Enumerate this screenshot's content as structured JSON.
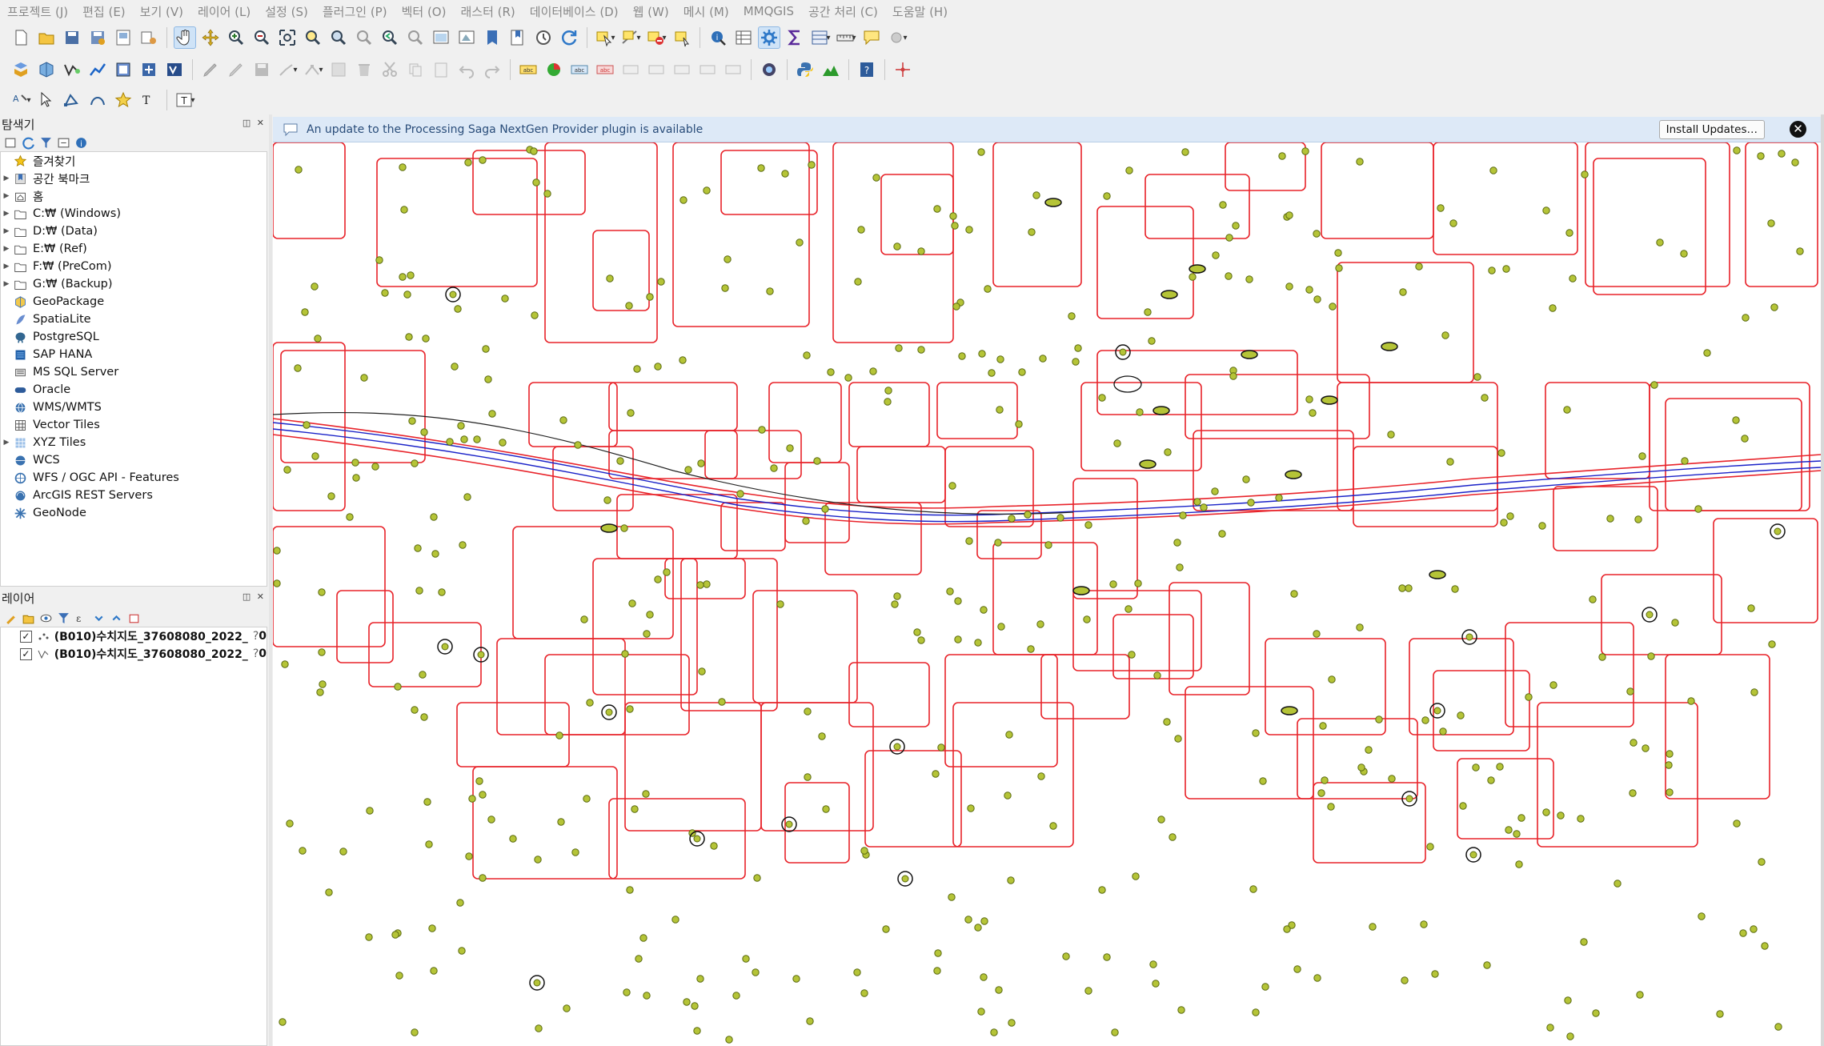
{
  "menu": [
    "프로젝트 (J)",
    "편집 (E)",
    "보기 (V)",
    "레이어 (L)",
    "설정 (S)",
    "플러그인 (P)",
    "벡터 (O)",
    "래스터 (R)",
    "데이터베이스 (D)",
    "웹 (W)",
    "메시 (M)",
    "MMQGIS",
    "공간 처리 (C)",
    "도움말 (H)"
  ],
  "browser": {
    "title": "탐색기",
    "items": [
      {
        "label": "즐겨찾기",
        "icon": "star-icon",
        "expandable": false
      },
      {
        "label": "공간 북마크",
        "icon": "bookmark-icon",
        "expandable": true
      },
      {
        "label": "홈",
        "icon": "home-folder-icon",
        "expandable": true
      },
      {
        "label": "C:₩ (Windows)",
        "icon": "folder-icon",
        "expandable": true
      },
      {
        "label": "D:₩ (Data)",
        "icon": "folder-icon",
        "expandable": true
      },
      {
        "label": "E:₩ (Ref)",
        "icon": "folder-icon",
        "expandable": true
      },
      {
        "label": "F:₩ (PreCom)",
        "icon": "folder-icon",
        "expandable": true
      },
      {
        "label": "G:₩ (Backup)",
        "icon": "folder-icon",
        "expandable": true
      },
      {
        "label": "GeoPackage",
        "icon": "geopackage-icon",
        "expandable": false
      },
      {
        "label": "SpatiaLite",
        "icon": "spatialite-icon",
        "expandable": false
      },
      {
        "label": "PostgreSQL",
        "icon": "postgresql-icon",
        "expandable": false
      },
      {
        "label": "SAP HANA",
        "icon": "sap-hana-icon",
        "expandable": false
      },
      {
        "label": "MS SQL Server",
        "icon": "mssql-icon",
        "expandable": false
      },
      {
        "label": "Oracle",
        "icon": "oracle-icon",
        "expandable": false
      },
      {
        "label": "WMS/WMTS",
        "icon": "wms-icon",
        "expandable": false
      },
      {
        "label": "Vector Tiles",
        "icon": "vector-tiles-icon",
        "expandable": false
      },
      {
        "label": "XYZ Tiles",
        "icon": "xyz-tiles-icon",
        "expandable": true
      },
      {
        "label": "WCS",
        "icon": "wcs-icon",
        "expandable": false
      },
      {
        "label": "WFS / OGC API - Features",
        "icon": "wfs-icon",
        "expandable": false
      },
      {
        "label": "ArcGIS REST Servers",
        "icon": "arcgis-icon",
        "expandable": false
      },
      {
        "label": "GeoNode",
        "icon": "geonode-icon",
        "expandable": false
      }
    ]
  },
  "layers": {
    "title": "레이어",
    "items": [
      {
        "label": "(B010)수치지도_37608080_2022_",
        "suffix": "0",
        "type": "point",
        "checked": true
      },
      {
        "label": "(B010)수치지도_37608080_2022_",
        "suffix": "0",
        "type": "line",
        "checked": true
      }
    ]
  },
  "message_bar": {
    "text": "An update to the Processing Saga NextGen Provider plugin is available",
    "button": "Install Updates…"
  },
  "colors": {
    "parcel_line": "#e8232a",
    "rail_line": "#1a22c8",
    "point_fill": "#b5c437",
    "point_stroke": "#5a6a10",
    "message_bg": "#dde9f7"
  }
}
